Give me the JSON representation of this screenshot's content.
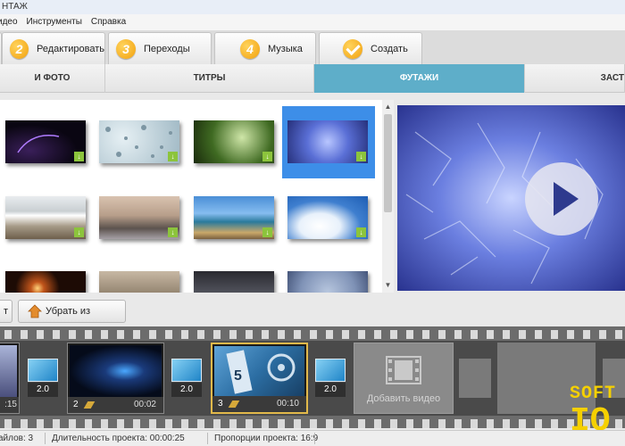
{
  "window": {
    "title": "НТАЖ"
  },
  "menu": {
    "items": [
      "идео",
      "Инструменты",
      "Справка"
    ]
  },
  "steps": [
    {
      "num": "2",
      "label": "Редактировать"
    },
    {
      "num": "3",
      "label": "Переходы"
    },
    {
      "num": "4",
      "label": "Музыка"
    },
    {
      "num": "",
      "label": "Создать"
    }
  ],
  "categories": [
    {
      "label": "И ФОТО"
    },
    {
      "label": "ТИТРЫ"
    },
    {
      "label": "ФУТАЖИ",
      "active": true
    },
    {
      "label": "ЗАСТ"
    }
  ],
  "buttons": {
    "left_partial": "т",
    "remove_from_project": "Убрать из проекта"
  },
  "timeline": {
    "clips": [
      {
        "index": "",
        "duration": ":15"
      },
      {
        "index": "2",
        "duration": "00:02"
      },
      {
        "index": "3",
        "duration": "00:10",
        "selected": true
      }
    ],
    "transitions": [
      "2.0",
      "2.0",
      "2.0"
    ],
    "add_video_label": "Добавить видео"
  },
  "status": {
    "files": "айлов: 3",
    "duration": "Длительность проекта:  00:00:25",
    "ratio": "Пропорции проекта:  16:9"
  },
  "watermark": {
    "line1": "SOFT",
    "line2": "IQ"
  },
  "colors": {
    "accent_tab": "#5eaec9",
    "selection": "#3d8ee8",
    "step_badge": "#f2a10d",
    "download_badge": "#8cc43c",
    "watermark": "#f5d000"
  }
}
